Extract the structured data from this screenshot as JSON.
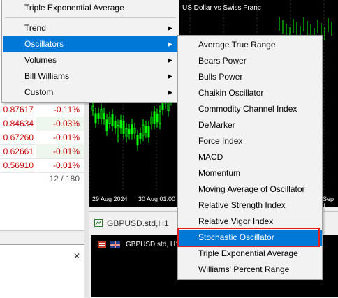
{
  "main_menu": {
    "top_item": "Triple Exponential Average",
    "items": [
      {
        "label": "Trend",
        "has_submenu": true
      },
      {
        "label": "Oscillators",
        "has_submenu": true,
        "highlighted": true
      },
      {
        "label": "Volumes",
        "has_submenu": true
      },
      {
        "label": "Bill Williams",
        "has_submenu": true
      },
      {
        "label": "Custom",
        "has_submenu": true
      }
    ],
    "arrow_icon": "triangle-right-icon"
  },
  "oscillators_submenu": {
    "items": [
      "Average True Range",
      "Bears Power",
      "Bulls Power",
      "Chaikin Oscillator",
      "Commodity Channel Index",
      "DeMarker",
      "Force Index",
      "MACD",
      "Momentum",
      "Moving Average of Oscillator",
      "Relative Strength Index",
      "Relative Vigor Index",
      "Stochastic Oscillator",
      "Triple Exponential Average",
      "Williams' Percent Range"
    ],
    "highlighted": "Stochastic Oscillator"
  },
  "market_watch": {
    "rows": [
      {
        "bid": "0.87617",
        "change": "-0.11%"
      },
      {
        "bid": "0.84634",
        "change": "-0.03%"
      },
      {
        "bid": "0.67260",
        "change": "-0.01%"
      },
      {
        "bid": "0.62661",
        "change": "-0.01%"
      },
      {
        "bid": "0.56910",
        "change": "-0.01%"
      }
    ],
    "count": "12 / 180",
    "close_icon": "close-icon"
  },
  "chart1": {
    "title": "US Dollar vs Swiss Franc",
    "dates": [
      "29 Aug 2024",
      "30 Aug 01:00",
      "Sep 1"
    ]
  },
  "chart2": {
    "tab_label": "GBPUSD.std,H1",
    "title": "GBPUSD.std, H1",
    "tab_icon": "chart-icon"
  },
  "colors": {
    "highlight": "#0078d7",
    "negative": "#c00000",
    "candle": "#00ff00",
    "annotation_box": "#e02020"
  }
}
